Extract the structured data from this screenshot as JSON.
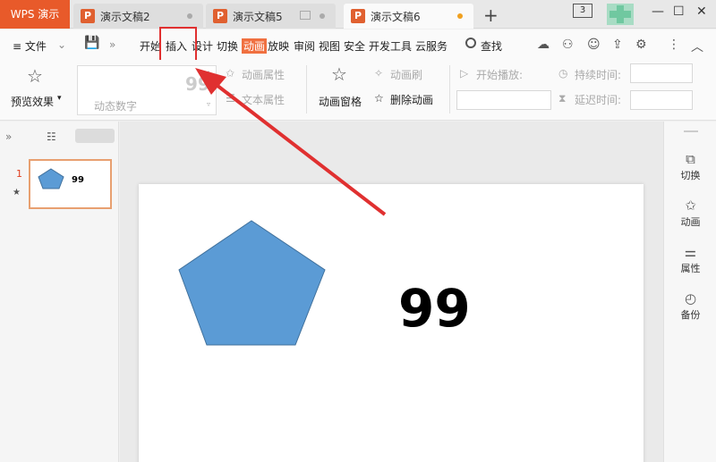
{
  "app": {
    "badge": "WPS 演示"
  },
  "tabs": [
    {
      "label": "演示文稿2",
      "icon": "P"
    },
    {
      "label": "演示文稿5",
      "icon": "P"
    },
    {
      "label": "演示文稿6",
      "icon": "P"
    }
  ],
  "window": {
    "badge_count": "3"
  },
  "menu": {
    "file": "≡ 文件",
    "items": [
      "开始",
      "插入",
      "设计",
      "切换",
      "动画",
      "放映",
      "审阅",
      "视图",
      "安全",
      "开发工具",
      "云服务"
    ],
    "search": "查找"
  },
  "ribbon": {
    "preview": "预览效果",
    "preview_value": "99",
    "anim_name": "动态数字",
    "anim_props": "动画属性",
    "text_props": "文本属性",
    "anim_pane": "动画窗格",
    "anim_brush": "动画刷",
    "delete_anim": "删除动画",
    "start_play": "开始播放:",
    "duration": "持续时间:",
    "delay": "延迟时间:"
  },
  "slide_panel": {
    "slide_number": "1",
    "thumb_text": "99"
  },
  "slide": {
    "text": "99",
    "shape_color": "#5b9bd5"
  },
  "right_panel": [
    {
      "label": "切换",
      "icon": "transition-icon"
    },
    {
      "label": "动画",
      "icon": "star-icon"
    },
    {
      "label": "属性",
      "icon": "properties-icon"
    },
    {
      "label": "备份",
      "icon": "history-icon"
    }
  ],
  "colors": {
    "accent": "#e85a2a",
    "annotation": "#e03030"
  }
}
